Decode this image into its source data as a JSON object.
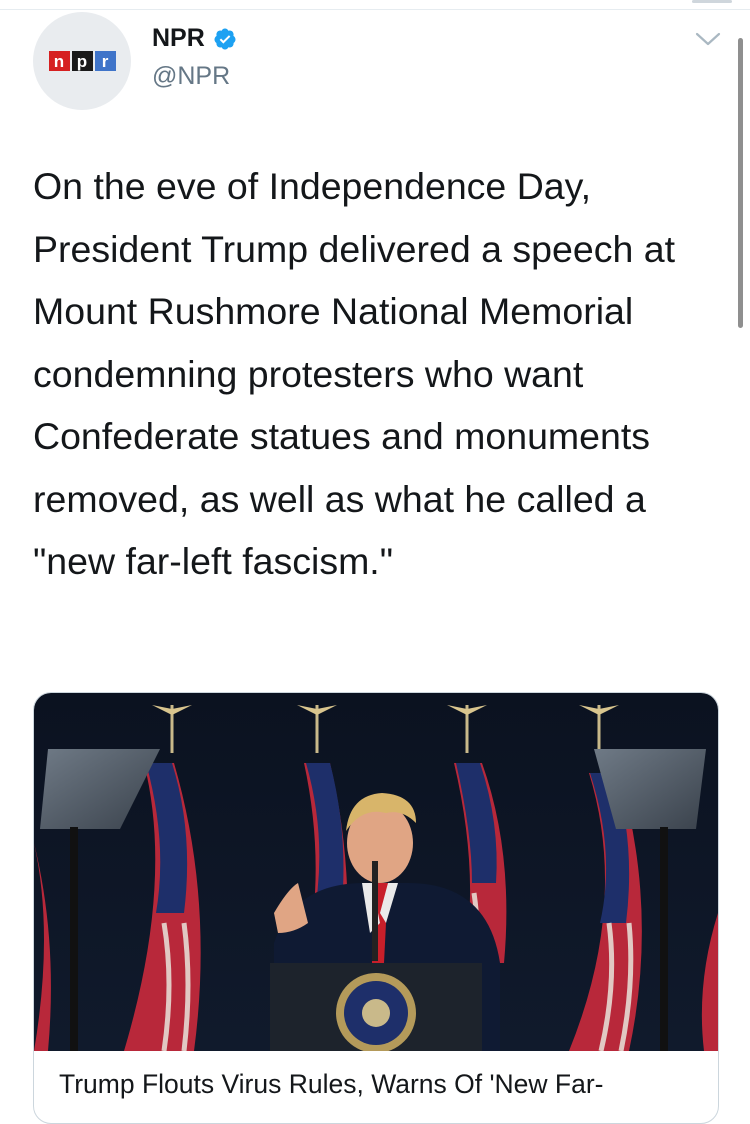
{
  "tweet": {
    "author": {
      "display_name": "NPR",
      "handle": "@NPR",
      "verified": true,
      "avatar_logo": [
        "n",
        "p",
        "r"
      ]
    },
    "text": "On the eve of Independence Day, President Trump delivered a speech at Mount Rushmore National Memorial condemning protesters who want Confederate statues and monuments removed, as well as what he called a \"new far-left fascism.\"",
    "icons": {
      "verified": "verified-badge-icon",
      "menu": "chevron-down-icon"
    }
  },
  "card": {
    "image_description_icon": "photo",
    "title": "Trump Flouts Virus Rules, Warns Of 'New Far-"
  },
  "colors": {
    "accent_blue": "#1da1f2",
    "text": "#14171a",
    "secondary_text": "#657786",
    "npr_red": "#d62021",
    "npr_black": "#1a1a1a",
    "npr_blue": "#3f74c9"
  }
}
